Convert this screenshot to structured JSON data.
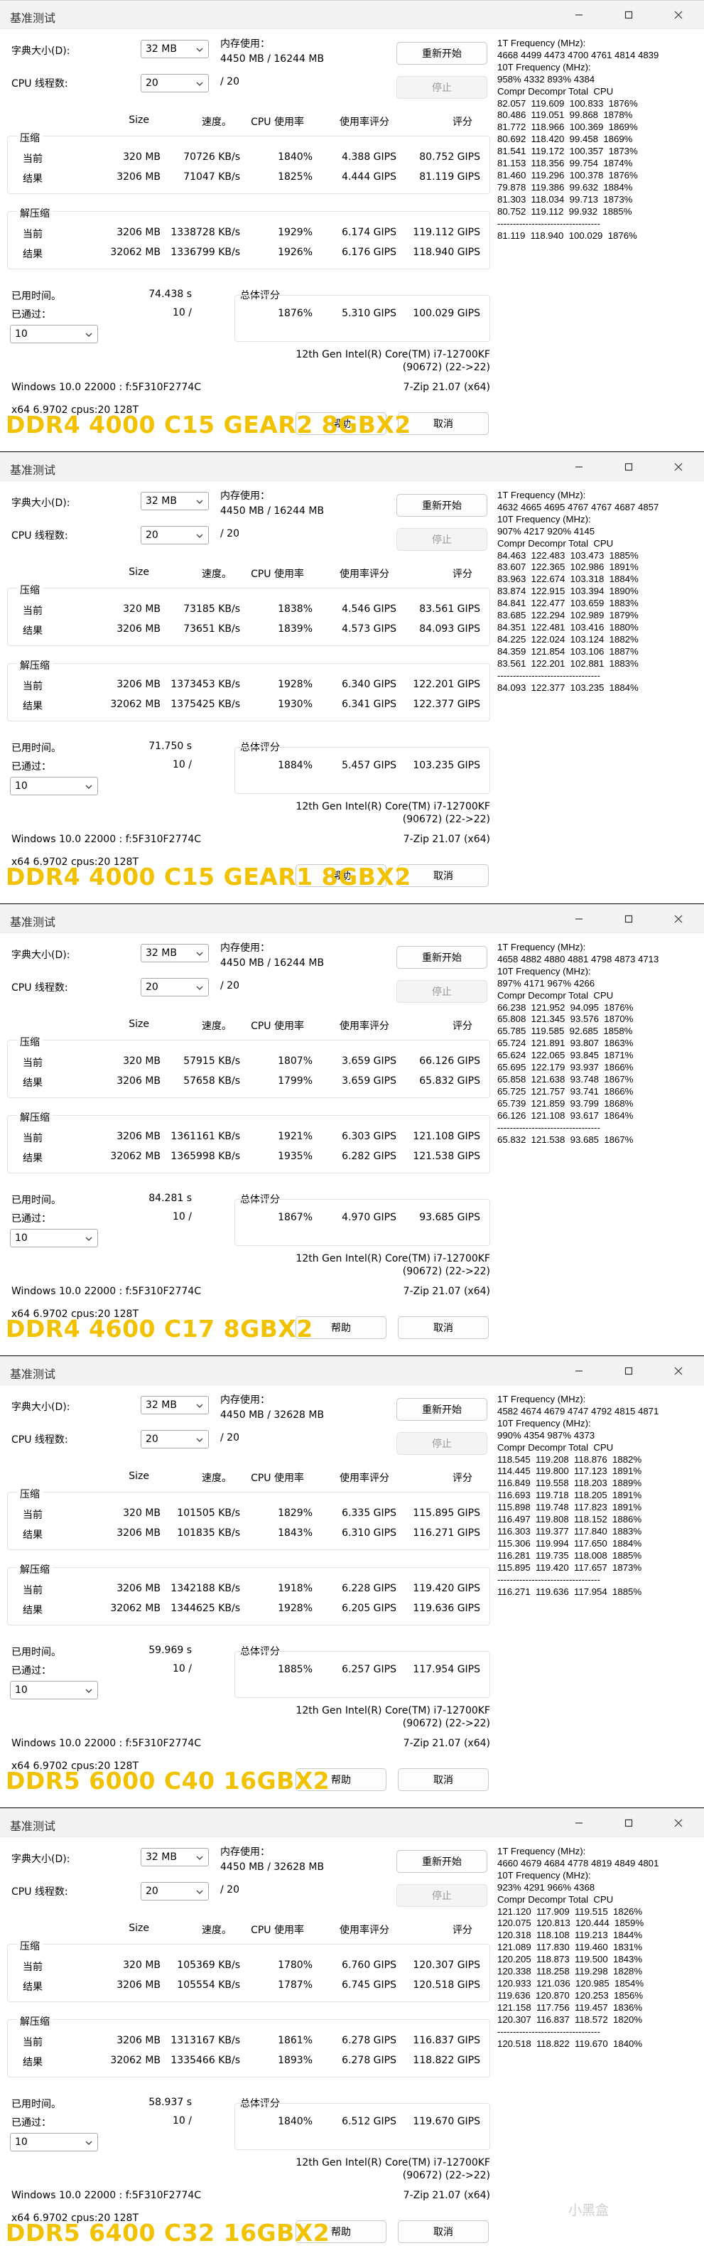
{
  "windows": [
    {
      "title": "基准测试",
      "dictionary_label": "字典大小(D):",
      "dictionary_value": "32 MB",
      "memory_label": "内存使用：",
      "memory_value": "4450 MB / 16244 MB",
      "threads_label": "CPU 线程数:",
      "threads_value": "20",
      "threads_total": "/ 20",
      "restart_button": "重新开始",
      "stop_button": "停止",
      "headers": {
        "size": "Size",
        "speed": "速度。",
        "cpu_usage": "CPU 使用率",
        "rating_usage": "使用率评分",
        "rating": "评分"
      },
      "compress_label": "压缩",
      "decompress_label": "解压缩",
      "current_label": "当前",
      "result_label": "结果",
      "compress_current": [
        "320 MB",
        "70726 KB/s",
        "1840%",
        "4.388 GIPS",
        "80.752 GIPS"
      ],
      "compress_result": [
        "3206 MB",
        "71047 KB/s",
        "1825%",
        "4.444 GIPS",
        "81.119 GIPS"
      ],
      "decompress_current": [
        "3206 MB",
        "1338728 KB/s",
        "1929%",
        "6.174 GIPS",
        "119.112 GIPS"
      ],
      "decompress_result": [
        "32062 MB",
        "1336799 KB/s",
        "1926%",
        "6.176 GIPS",
        "118.940 GIPS"
      ],
      "elapsed_label": "已用时间。",
      "elapsed_value": "74.438 s",
      "passes_label": "已通过：",
      "passes_value": "10 /",
      "passes_select": "10",
      "total_label": "总体评分",
      "total_cpu": "1876%",
      "total_rating_usage": "5.310 GIPS",
      "total_rating": "100.029 GIPS",
      "cpu_name": "12th Gen Intel(R) Core(TM) i7-12700KF",
      "cpu_code": "(90672) (22->22)",
      "os_info": "Windows 10.0 22000 : f:5F310F2774C",
      "zip_version": "7-Zip 21.07 (x64)",
      "arch_info": "x64 6.9702 cpus:20 128T",
      "help_button": "帮助",
      "cancel_button": "取消",
      "freq_lines": [
        "1T Frequency (MHz):",
        "4668 4499 4473 4700 4761 4814 4839",
        "10T Frequency (MHz):",
        "958% 4332 893% 4384",
        "Compr Decompr Total  CPU",
        "82.057  119.609  100.833  1876%",
        "80.486  119.051  99.868  1878%",
        "81.772  118.966  100.369  1869%",
        "80.692  118.420  99.458  1869%",
        "81.541  119.172  100.357  1873%",
        "81.153  118.356  99.754  1874%",
        "81.460  119.296  100.378  1876%",
        "79.878  119.386  99.632  1884%",
        "81.303  118.034  99.713  1873%",
        "80.752  119.112  99.932  1885%",
        "---------------------------------",
        "81.119  118.940  100.029  1876%"
      ],
      "overlay": "DDR4 4000 C15 GEAR2 8GBX2"
    },
    {
      "title": "基准测试",
      "dictionary_label": "字典大小(D):",
      "dictionary_value": "32 MB",
      "memory_label": "内存使用：",
      "memory_value": "4450 MB / 16244 MB",
      "threads_label": "CPU 线程数:",
      "threads_value": "20",
      "threads_total": "/ 20",
      "restart_button": "重新开始",
      "stop_button": "停止",
      "headers": {
        "size": "Size",
        "speed": "速度。",
        "cpu_usage": "CPU 使用率",
        "rating_usage": "使用率评分",
        "rating": "评分"
      },
      "compress_label": "压缩",
      "decompress_label": "解压缩",
      "current_label": "当前",
      "result_label": "结果",
      "compress_current": [
        "320 MB",
        "73185 KB/s",
        "1838%",
        "4.546 GIPS",
        "83.561 GIPS"
      ],
      "compress_result": [
        "3206 MB",
        "73651 KB/s",
        "1839%",
        "4.573 GIPS",
        "84.093 GIPS"
      ],
      "decompress_current": [
        "3206 MB",
        "1373453 KB/s",
        "1928%",
        "6.340 GIPS",
        "122.201 GIPS"
      ],
      "decompress_result": [
        "32062 MB",
        "1375425 KB/s",
        "1930%",
        "6.341 GIPS",
        "122.377 GIPS"
      ],
      "elapsed_label": "已用时间。",
      "elapsed_value": "71.750 s",
      "passes_label": "已通过：",
      "passes_value": "10 /",
      "passes_select": "10",
      "total_label": "总体评分",
      "total_cpu": "1884%",
      "total_rating_usage": "5.457 GIPS",
      "total_rating": "103.235 GIPS",
      "cpu_name": "12th Gen Intel(R) Core(TM) i7-12700KF",
      "cpu_code": "(90672) (22->22)",
      "os_info": "Windows 10.0 22000 : f:5F310F2774C",
      "zip_version": "7-Zip 21.07 (x64)",
      "arch_info": "x64 6.9702 cpus:20 128T",
      "help_button": "帮助",
      "cancel_button": "取消",
      "freq_lines": [
        "1T Frequency (MHz):",
        "4632 4665 4695 4767 4767 4687 4857",
        "10T Frequency (MHz):",
        "907% 4217 920% 4145",
        "Compr Decompr Total  CPU",
        "84.463  122.483  103.473  1885%",
        "83.607  122.365  102.986  1891%",
        "83.963  122.674  103.318  1884%",
        "83.874  122.915  103.394  1890%",
        "84.841  122.477  103.659  1883%",
        "83.685  122.294  102.989  1879%",
        "84.351  122.481  103.416  1880%",
        "84.225  122.024  103.124  1882%",
        "84.359  121.854  103.106  1887%",
        "83.561  122.201  102.881  1883%",
        "---------------------------------",
        "84.093  122.377  103.235  1884%"
      ],
      "overlay": "DDR4 4000 C15 GEAR1 8GBX2"
    },
    {
      "title": "基准测试",
      "dictionary_label": "字典大小(D):",
      "dictionary_value": "32 MB",
      "memory_label": "内存使用：",
      "memory_value": "4450 MB / 16244 MB",
      "threads_label": "CPU 线程数:",
      "threads_value": "20",
      "threads_total": "/ 20",
      "restart_button": "重新开始",
      "stop_button": "停止",
      "headers": {
        "size": "Size",
        "speed": "速度。",
        "cpu_usage": "CPU 使用率",
        "rating_usage": "使用率评分",
        "rating": "评分"
      },
      "compress_label": "压缩",
      "decompress_label": "解压缩",
      "current_label": "当前",
      "result_label": "结果",
      "compress_current": [
        "320 MB",
        "57915 KB/s",
        "1807%",
        "3.659 GIPS",
        "66.126 GIPS"
      ],
      "compress_result": [
        "3206 MB",
        "57658 KB/s",
        "1799%",
        "3.659 GIPS",
        "65.832 GIPS"
      ],
      "decompress_current": [
        "3206 MB",
        "1361161 KB/s",
        "1921%",
        "6.303 GIPS",
        "121.108 GIPS"
      ],
      "decompress_result": [
        "32062 MB",
        "1365998 KB/s",
        "1935%",
        "6.282 GIPS",
        "121.538 GIPS"
      ],
      "elapsed_label": "已用时间。",
      "elapsed_value": "84.281 s",
      "passes_label": "已通过：",
      "passes_value": "10 /",
      "passes_select": "10",
      "total_label": "总体评分",
      "total_cpu": "1867%",
      "total_rating_usage": "4.970 GIPS",
      "total_rating": "93.685 GIPS",
      "cpu_name": "12th Gen Intel(R) Core(TM) i7-12700KF",
      "cpu_code": "(90672) (22->22)",
      "os_info": "Windows 10.0 22000 : f:5F310F2774C",
      "zip_version": "7-Zip 21.07 (x64)",
      "arch_info": "x64 6.9702 cpus:20 128T",
      "help_button": "帮助",
      "cancel_button": "取消",
      "freq_lines": [
        "1T Frequency (MHz):",
        "4658 4882 4880 4881 4798 4873 4713",
        "10T Frequency (MHz):",
        "897% 4171 967% 4266",
        "Compr Decompr Total  CPU",
        "66.238  121.952  94.095  1876%",
        "65.808  121.345  93.576  1870%",
        "65.785  119.585  92.685  1858%",
        "65.724  121.891  93.807  1863%",
        "65.624  122.065  93.845  1871%",
        "65.695  122.179  93.937  1866%",
        "65.858  121.638  93.748  1867%",
        "65.725  121.757  93.741  1866%",
        "65.739  121.859  93.799  1868%",
        "66.126  121.108  93.617  1864%",
        "---------------------------------",
        "65.832  121.538  93.685  1867%"
      ],
      "overlay": "DDR4 4600 C17 8GBX2"
    },
    {
      "title": "基准测试",
      "dictionary_label": "字典大小(D):",
      "dictionary_value": "32 MB",
      "memory_label": "内存使用：",
      "memory_value": "4450 MB / 32628 MB",
      "threads_label": "CPU 线程数:",
      "threads_value": "20",
      "threads_total": "/ 20",
      "restart_button": "重新开始",
      "stop_button": "停止",
      "headers": {
        "size": "Size",
        "speed": "速度。",
        "cpu_usage": "CPU 使用率",
        "rating_usage": "使用率评分",
        "rating": "评分"
      },
      "compress_label": "压缩",
      "decompress_label": "解压缩",
      "current_label": "当前",
      "result_label": "结果",
      "compress_current": [
        "320 MB",
        "101505 KB/s",
        "1829%",
        "6.335 GIPS",
        "115.895 GIPS"
      ],
      "compress_result": [
        "3206 MB",
        "101835 KB/s",
        "1843%",
        "6.310 GIPS",
        "116.271 GIPS"
      ],
      "decompress_current": [
        "3206 MB",
        "1342188 KB/s",
        "1918%",
        "6.228 GIPS",
        "119.420 GIPS"
      ],
      "decompress_result": [
        "32062 MB",
        "1344625 KB/s",
        "1928%",
        "6.205 GIPS",
        "119.636 GIPS"
      ],
      "elapsed_label": "已用时间。",
      "elapsed_value": "59.969 s",
      "passes_label": "已通过：",
      "passes_value": "10 /",
      "passes_select": "10",
      "total_label": "总体评分",
      "total_cpu": "1885%",
      "total_rating_usage": "6.257 GIPS",
      "total_rating": "117.954 GIPS",
      "cpu_name": "12th Gen Intel(R) Core(TM) i7-12700KF",
      "cpu_code": "(90672) (22->22)",
      "os_info": "Windows 10.0 22000 : f:5F310F2774C",
      "zip_version": "7-Zip 21.07 (x64)",
      "arch_info": "x64 6.9702 cpus:20 128T",
      "help_button": "帮助",
      "cancel_button": "取消",
      "freq_lines": [
        "1T Frequency (MHz):",
        "4582 4674 4679 4747 4792 4815 4871",
        "10T Frequency (MHz):",
        "990% 4354 987% 4373",
        "Compr Decompr Total  CPU",
        "118.545  119.208  118.876  1882%",
        "114.445  119.800  117.123  1891%",
        "116.849  119.558  118.203  1889%",
        "116.693  119.718  118.205  1891%",
        "115.898  119.748  117.823  1891%",
        "116.497  119.808  118.152  1886%",
        "116.303  119.377  117.840  1883%",
        "115.306  119.994  117.650  1884%",
        "116.281  119.735  118.008  1885%",
        "115.895  119.420  117.657  1873%",
        "---------------------------------",
        "116.271  119.636  117.954  1885%"
      ],
      "overlay": "DDR5 6000 C40 16GBX2"
    },
    {
      "title": "基准测试",
      "dictionary_label": "字典大小(D):",
      "dictionary_value": "32 MB",
      "memory_label": "内存使用：",
      "memory_value": "4450 MB / 32628 MB",
      "threads_label": "CPU 线程数:",
      "threads_value": "20",
      "threads_total": "/ 20",
      "restart_button": "重新开始",
      "stop_button": "停止",
      "headers": {
        "size": "Size",
        "speed": "速度。",
        "cpu_usage": "CPU 使用率",
        "rating_usage": "使用率评分",
        "rating": "评分"
      },
      "compress_label": "压缩",
      "decompress_label": "解压缩",
      "current_label": "当前",
      "result_label": "结果",
      "compress_current": [
        "320 MB",
        "105369 KB/s",
        "1780%",
        "6.760 GIPS",
        "120.307 GIPS"
      ],
      "compress_result": [
        "3206 MB",
        "105554 KB/s",
        "1787%",
        "6.745 GIPS",
        "120.518 GIPS"
      ],
      "decompress_current": [
        "3206 MB",
        "1313167 KB/s",
        "1861%",
        "6.278 GIPS",
        "116.837 GIPS"
      ],
      "decompress_result": [
        "32062 MB",
        "1335466 KB/s",
        "1893%",
        "6.278 GIPS",
        "118.822 GIPS"
      ],
      "elapsed_label": "已用时间。",
      "elapsed_value": "58.937 s",
      "passes_label": "已通过：",
      "passes_value": "10 /",
      "passes_select": "10",
      "total_label": "总体评分",
      "total_cpu": "1840%",
      "total_rating_usage": "6.512 GIPS",
      "total_rating": "119.670 GIPS",
      "cpu_name": "12th Gen Intel(R) Core(TM) i7-12700KF",
      "cpu_code": "(90672) (22->22)",
      "os_info": "Windows 10.0 22000 : f:5F310F2774C",
      "zip_version": "7-Zip 21.07 (x64)",
      "arch_info": "x64 6.9702 cpus:20 128T",
      "help_button": "帮助",
      "cancel_button": "取消",
      "freq_lines": [
        "1T Frequency (MHz):",
        "4660 4679 4684 4778 4819 4849 4801",
        "10T Frequency (MHz):",
        "923% 4291 966% 4368",
        "Compr Decompr Total  CPU",
        "121.120  117.909  119.515  1826%",
        "120.075  120.813  120.444  1859%",
        "120.318  118.108  119.213  1844%",
        "121.089  117.830  119.460  1831%",
        "120.205  118.873  119.500  1843%",
        "120.338  118.258  119.298  1828%",
        "120.933  121.036  120.985  1854%",
        "119.636  120.870  120.253  1856%",
        "121.158  117.756  119.457  1836%",
        "120.307  116.837  118.572  1820%",
        "---------------------------------",
        "120.518  118.822  119.670  1840%"
      ],
      "overlay": "DDR5 6400 C32 16GBX2"
    }
  ],
  "watermark": "小黑盒"
}
